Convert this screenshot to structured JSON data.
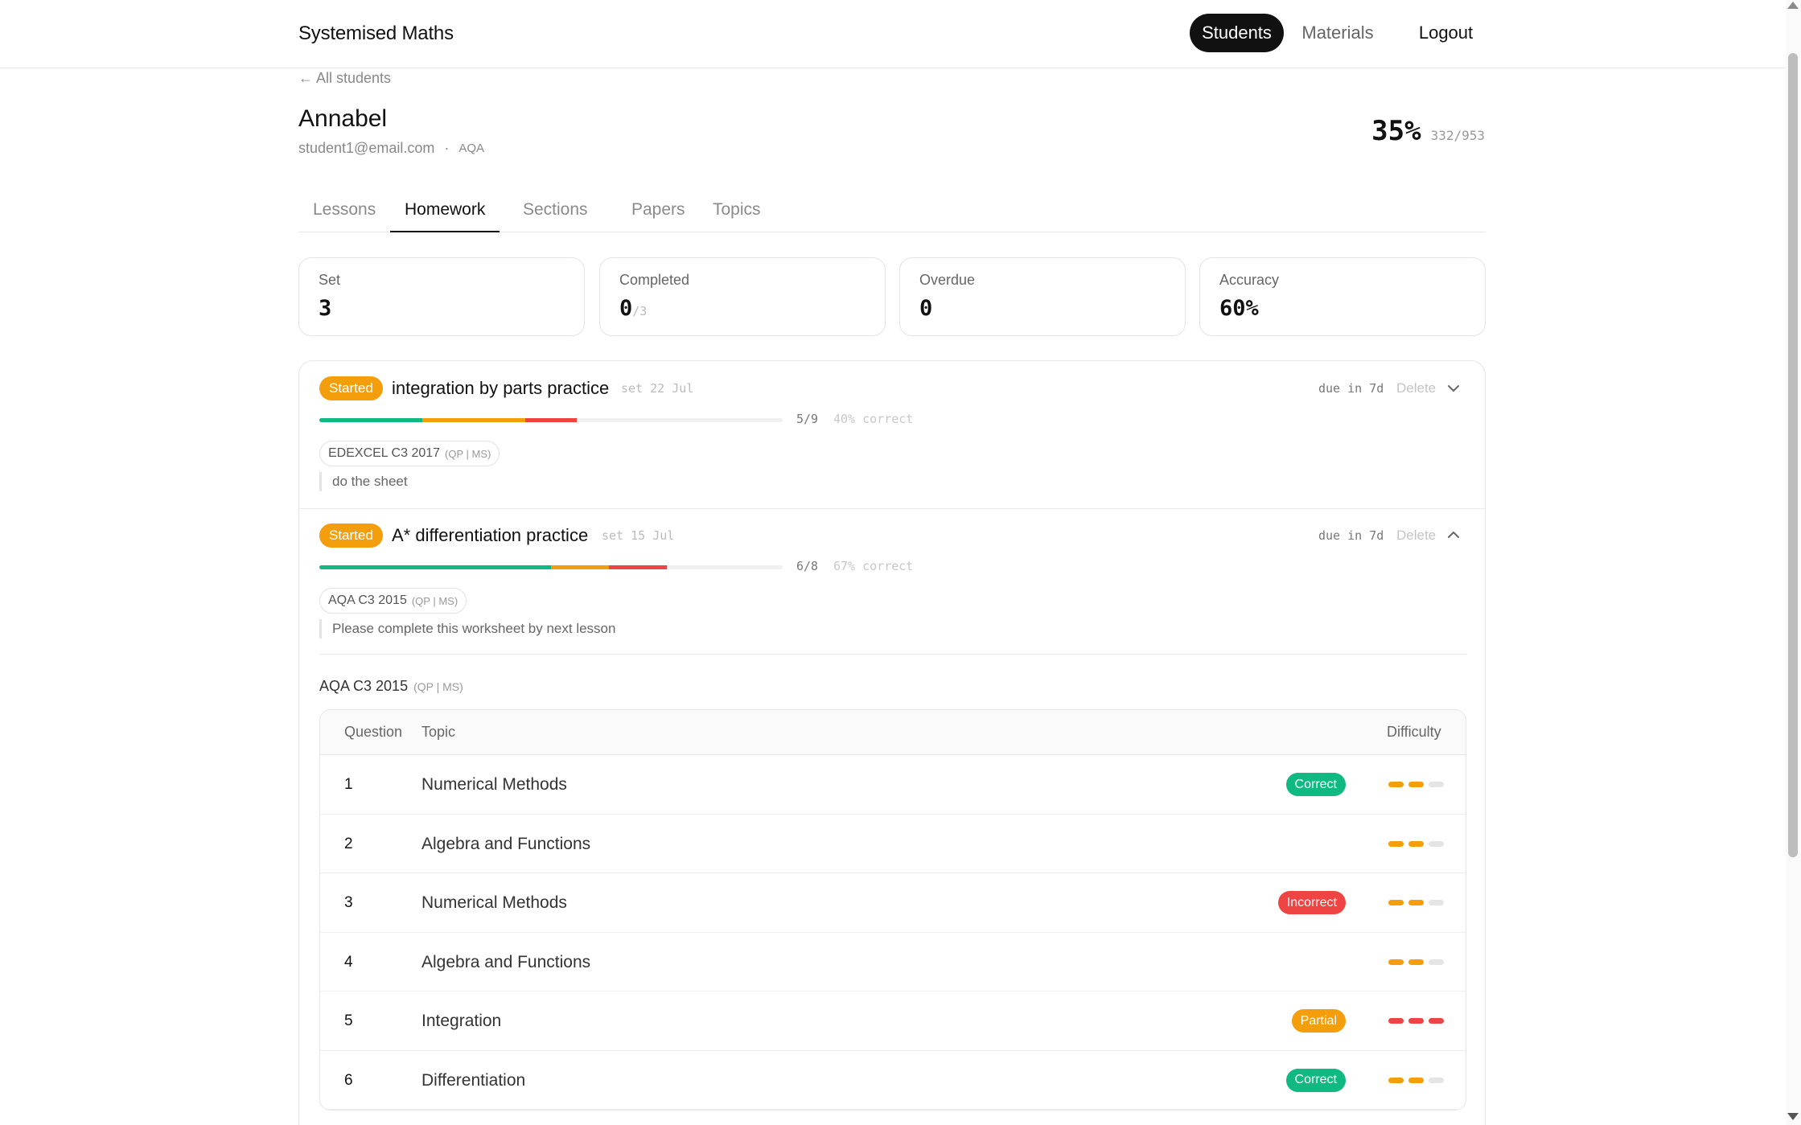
{
  "nav": {
    "brand": "Systemised Maths",
    "students": "Students",
    "materials": "Materials",
    "logout": "Logout"
  },
  "student": {
    "back_link": "← All students",
    "name": "Annabel",
    "email": "student1@email.com",
    "separator": "·",
    "board": "AQA",
    "score_percent": "35%",
    "score_fraction": "332/953"
  },
  "tabs": [
    "Lessons",
    "Homework",
    "Sections",
    "Papers",
    "Topics"
  ],
  "active_tab": "Homework",
  "stats": {
    "set": {
      "label": "Set",
      "value": "3"
    },
    "completed": {
      "label": "Completed",
      "value": "0",
      "denominator": "/3"
    },
    "overdue": {
      "label": "Overdue",
      "value": "0"
    },
    "accuracy": {
      "label": "Accuracy",
      "value": "60%"
    }
  },
  "homework": [
    {
      "status": "Started",
      "title": "integration by parts practice",
      "set_date": "set 22 Jul",
      "due": "due in 7d",
      "delete": "Delete",
      "expanded": false,
      "progress_fractions": {
        "correct": 0.222,
        "partial": 0.222,
        "incorrect": 0.111
      },
      "count": "5/9",
      "correct_text": "40% correct",
      "paper": {
        "name": "EDEXCEL C3 2017",
        "links": "(QP | MS)"
      },
      "note": "do the sheet"
    },
    {
      "status": "Started",
      "title": "A* differentiation practice",
      "set_date": "set 15 Jul",
      "due": "due in 7d",
      "delete": "Delete",
      "expanded": true,
      "progress_fractions": {
        "correct": 0.5,
        "partial": 0.125,
        "incorrect": 0.125
      },
      "count": "6/8",
      "correct_text": "67% correct",
      "paper": {
        "name": "AQA C3 2015",
        "links": "(QP | MS)"
      },
      "note": "Please complete this worksheet by next lesson"
    }
  ],
  "question_table": {
    "paper_name": "AQA C3 2015",
    "paper_links": "(QP | MS)",
    "headers": {
      "question": "Question",
      "topic": "Topic",
      "difficulty": "Difficulty"
    },
    "rows": [
      {
        "q": "1",
        "topic": "Numerical Methods",
        "status": "Correct",
        "difficulty": 2,
        "difficulty_color": "orange"
      },
      {
        "q": "2",
        "topic": "Algebra and Functions",
        "status": "",
        "difficulty": 2,
        "difficulty_color": "orange"
      },
      {
        "q": "3",
        "topic": "Numerical Methods",
        "status": "Incorrect",
        "difficulty": 2,
        "difficulty_color": "orange"
      },
      {
        "q": "4",
        "topic": "Algebra and Functions",
        "status": "",
        "difficulty": 2,
        "difficulty_color": "orange"
      },
      {
        "q": "5",
        "topic": "Integration",
        "status": "Partial",
        "difficulty": 3,
        "difficulty_color": "red"
      },
      {
        "q": "6",
        "topic": "Differentiation",
        "status": "Correct",
        "difficulty": 2,
        "difficulty_color": "orange"
      }
    ]
  },
  "colors": {
    "correct": "#10b981",
    "partial": "#f59e0b",
    "incorrect": "#ef4444",
    "primary": "#111111"
  }
}
